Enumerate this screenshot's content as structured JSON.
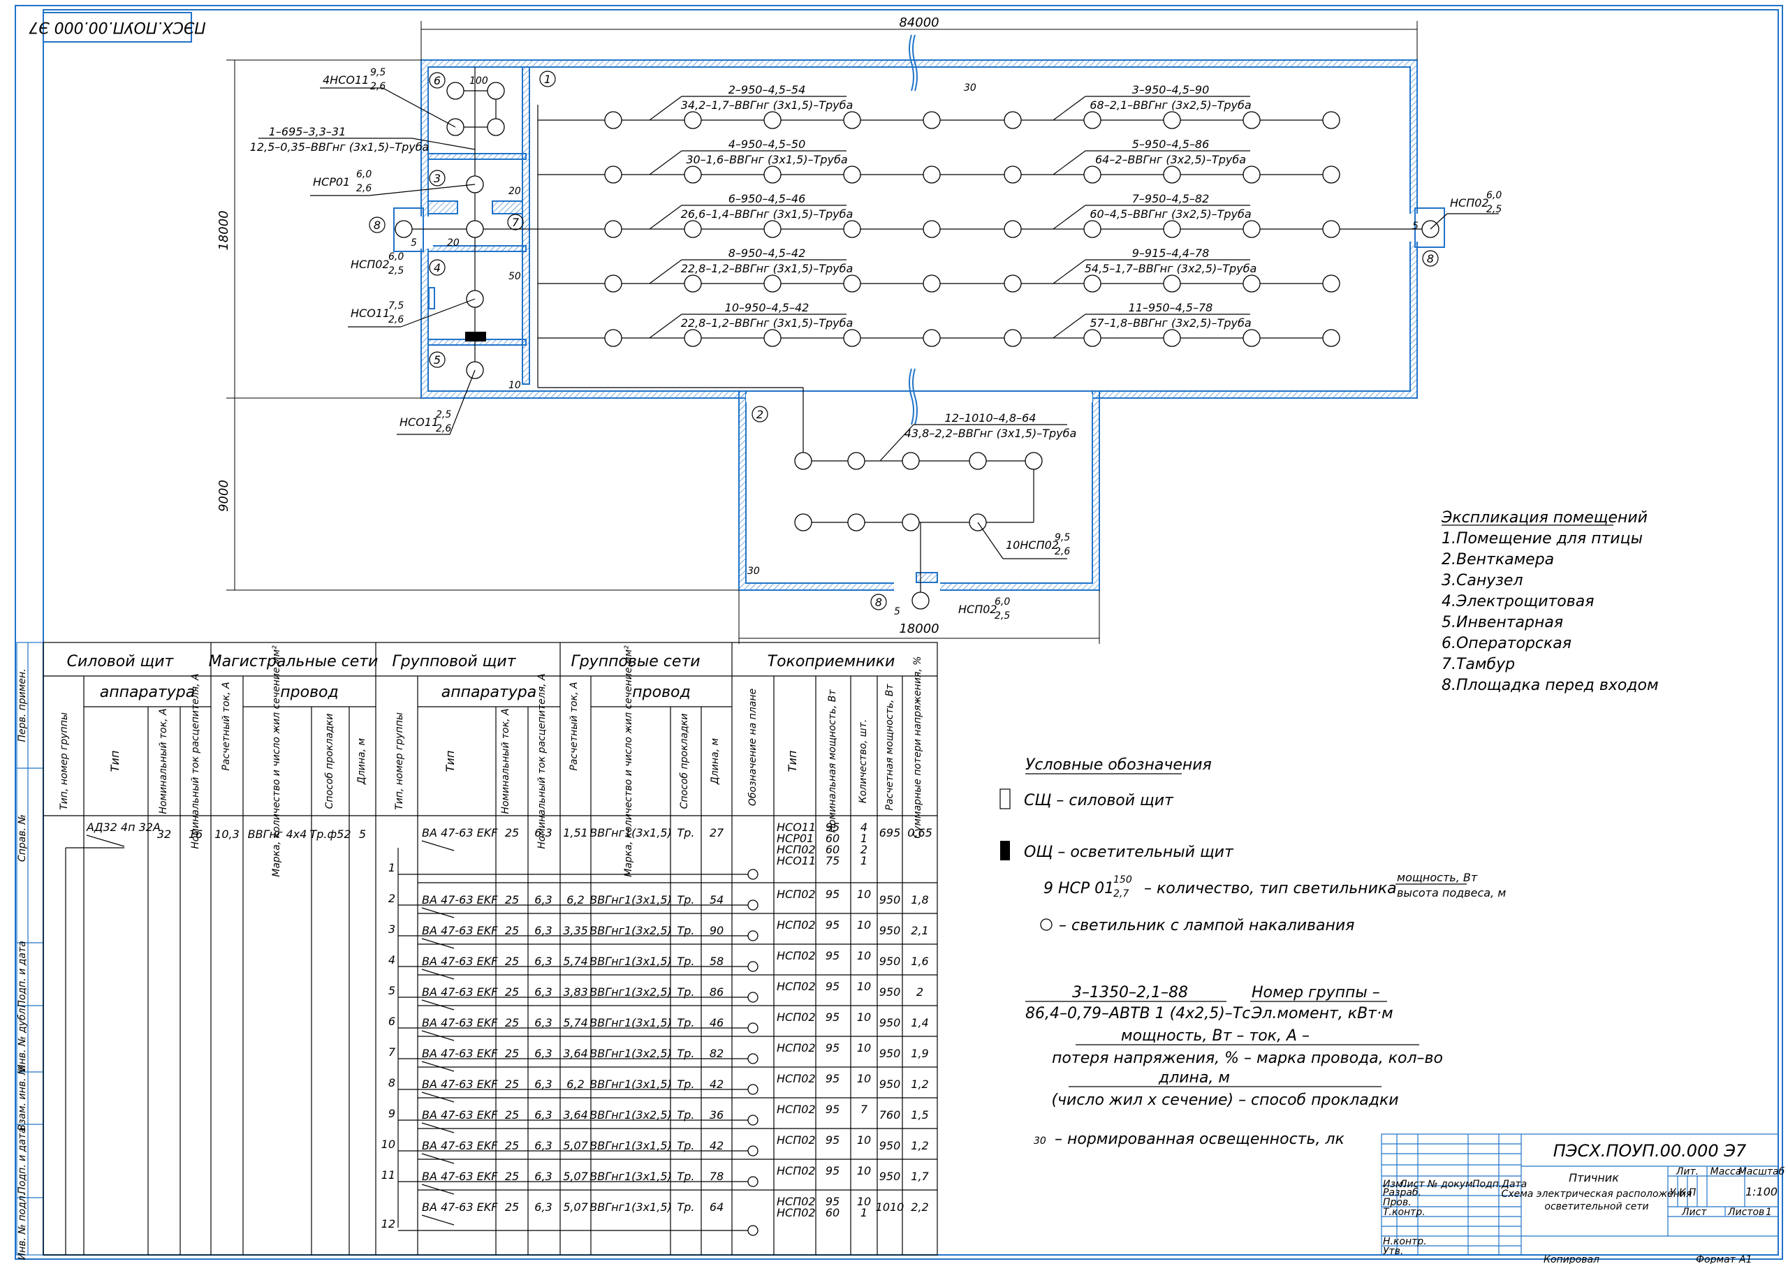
{
  "stamp_code": "ПЭСХ.ПОУП.00.000 Э7",
  "dimensions": {
    "overall_width": "84000",
    "depth_main": "18000",
    "depth_annex": "9000",
    "annex_width": "18000"
  },
  "rooms": [
    "1",
    "2",
    "3",
    "4",
    "5",
    "6",
    "7",
    "8"
  ],
  "group_labels": [
    {
      "top": "2–950–4,5–54",
      "bottom": "34,2–1,7–ВВГнг (3х1,5)–Труба"
    },
    {
      "top": "3–950–4,5–90",
      "bottom": "68–2,1–ВВГнг (3х2,5)–Труба"
    },
    {
      "top": "4–950–4,5–50",
      "bottom": "30–1,6–ВВГнг (3х1,5)–Труба"
    },
    {
      "top": "5–950–4,5–86",
      "bottom": "64–2–ВВГнг (3х2,5)–Труба"
    },
    {
      "top": "6–950–4,5–46",
      "bottom": "26,6–1,4–ВВГнг (3х1,5)–Труба"
    },
    {
      "top": "7–950–4,5–82",
      "bottom": "60–4,5–ВВГнг (3х2,5)–Труба"
    },
    {
      "top": "8–950–4,5–42",
      "bottom": "22,8–1,2–ВВГнг (3х1,5)–Труба"
    },
    {
      "top": "9–915–4,4–78",
      "bottom": "54,5–1,7–ВВГнг (3х2,5)–Труба"
    },
    {
      "top": "10–950–4,5–42",
      "bottom": "22,8–1,2–ВВГнг (3х1,5)–Труба"
    },
    {
      "top": "11–950–4,5–78",
      "bottom": "57–1,8–ВВГнг (3х2,5)–Труба"
    },
    {
      "top": "12–1010–4,8–64",
      "bottom": "43,8–2,2–ВВГнг (3х1,5)–Труба"
    },
    {
      "top": "1–695–3,3–31",
      "bottom": "12,5–0,35–ВВГнг (3х1,5)–Труба"
    }
  ],
  "lamp_labels": {
    "l1": {
      "name": "4НСО11",
      "num": "9,5",
      "den": "2,6"
    },
    "l2": {
      "name": "НСР01",
      "num": "6,0",
      "den": "2,6"
    },
    "l3": {
      "name": "НСП02",
      "num": "6,0",
      "den": "2,5"
    },
    "l4": {
      "name": "НСО11",
      "num": "7,5",
      "den": "2,6"
    },
    "l5": {
      "name": "НСО11",
      "num": "2,5",
      "den": "2,6"
    },
    "l6": {
      "name": "НСП02",
      "num": "6,0",
      "den": "2,5"
    },
    "l7": {
      "name": "10НСП02",
      "num": "9,5",
      "den": "2,6"
    },
    "l8": {
      "name": "НСП02",
      "num": "6,0",
      "den": "2,5"
    }
  },
  "lux": [
    "100",
    "30",
    "20",
    "20",
    "50",
    "10",
    "30",
    "5",
    "5",
    "5"
  ],
  "explication": {
    "title": "Экспликация помещений",
    "items": [
      "1.Помещение для птицы",
      "2.Венткамера",
      "3.Санузел",
      "4.Электрощитовая",
      "5.Инвентарная",
      "6.Операторская",
      "7.Тамбур",
      "8.Площадка перед входом"
    ]
  },
  "legend": {
    "title": "Условные обозначения",
    "sch": "СЩ – силовой щит",
    "osch": "ОЩ – осветительный щит",
    "lamp_type_example": "9 НСР 01",
    "lamp_type_num": "150",
    "lamp_type_den": "2,7",
    "lamp_type_text": "– количество, тип светильника",
    "power_label": "мощность, Вт",
    "height_label": "высота подвеса, м",
    "lamp_text": "– светильник с лампой накаливания",
    "formula_top": "3–1350–2,1–88",
    "formula_bottom": "86,4–0,79–АВТВ 1 (4х2,5)–Тс.",
    "desc1": "Номер группы  –",
    "desc2": "Эл.момент, кВт·м",
    "desc3": "мощность, Вт – ток, А –",
    "desc4": "потеря напряжения, % – марка провода, кол–во",
    "desc5": "длина, м",
    "desc6": "(число жил х сечение) – способ прокладки",
    "lux_value": "30",
    "lux_text": "– нормированная освещенность, лк"
  },
  "table": {
    "h_power_panel": "Силовой щит",
    "h_mains": "Магистральные сети",
    "h_group_panel": "Групповой щит",
    "h_group_nets": "Групповые сети",
    "h_receivers": "Токоприемники",
    "h_apparatus": "аппаратура",
    "h_wire": "провод",
    "col_type_group": "Тип, номер группы",
    "col_type": "Тип",
    "col_nom_current": "Номинальный ток, А",
    "col_trip_current": "Номинальный ток расцепителя, А",
    "col_calc_current": "Расчетный ток, А",
    "col_brand": "Марка, количество и число жил сечение,мм²",
    "col_method": "Способ прокладки",
    "col_length": "Длина, м",
    "col_designation": "Обозначение на плане",
    "col_nom_power": "Номинальная мощность, Вт",
    "col_qty": "Количество, шт.",
    "col_calc_power": "Расчетная мощность, Вт",
    "col_loss": "Суммарные потери напряжения, %",
    "main": {
      "type": "АД32 4п 32А",
      "nom": "32",
      "trip": "16",
      "calc": "10,3",
      "wire": "ВВГнг 4х4",
      "method": "Тр.ф52",
      "len": "5"
    },
    "rows": [
      {
        "g": "1",
        "type": "ВА 47-63 EKF",
        "nom": "25",
        "trip": "6,3",
        "calc": "1,51",
        "wire": "ВВГнг1(3х1,5)",
        "m": "Тр.",
        "len": "27",
        "lamps": [
          "НСО11",
          "НСР01",
          "НСП02",
          "НСО11"
        ],
        "pw": [
          "95",
          "60",
          "60",
          "75"
        ],
        "qty": [
          "4",
          "1",
          "2",
          "1"
        ],
        "cp": "695",
        "loss": "0,65"
      },
      {
        "g": "2",
        "type": "ВА 47-63 EKF",
        "nom": "25",
        "trip": "6,3",
        "calc": "6,2",
        "wire": "ВВГнг1(3х1,5)",
        "m": "Тр.",
        "len": "54",
        "lamps": [
          "НСП02"
        ],
        "pw": [
          "95"
        ],
        "qty": [
          "10"
        ],
        "cp": "950",
        "loss": "1,8"
      },
      {
        "g": "3",
        "type": "ВА 47-63 EKF",
        "nom": "25",
        "trip": "6,3",
        "calc": "3,35",
        "wire": "ВВГнг1(3х2,5)",
        "m": "Тр.",
        "len": "90",
        "lamps": [
          "НСП02"
        ],
        "pw": [
          "95"
        ],
        "qty": [
          "10"
        ],
        "cp": "950",
        "loss": "2,1"
      },
      {
        "g": "4",
        "type": "ВА 47-63 EKF",
        "nom": "25",
        "trip": "6,3",
        "calc": "5,74",
        "wire": "ВВГнг1(3х1,5)",
        "m": "Тр.",
        "len": "58",
        "lamps": [
          "НСП02"
        ],
        "pw": [
          "95"
        ],
        "qty": [
          "10"
        ],
        "cp": "950",
        "loss": "1,6"
      },
      {
        "g": "5",
        "type": "ВА 47-63 EKF",
        "nom": "25",
        "trip": "6,3",
        "calc": "3,83",
        "wire": "ВВГнг1(3х2,5)",
        "m": "Тр.",
        "len": "86",
        "lamps": [
          "НСП02"
        ],
        "pw": [
          "95"
        ],
        "qty": [
          "10"
        ],
        "cp": "950",
        "loss": "2"
      },
      {
        "g": "6",
        "type": "ВА 47-63 EKF",
        "nom": "25",
        "trip": "6,3",
        "calc": "5,74",
        "wire": "ВВГнг1(3х1,5)",
        "m": "Тр.",
        "len": "46",
        "lamps": [
          "НСП02"
        ],
        "pw": [
          "95"
        ],
        "qty": [
          "10"
        ],
        "cp": "950",
        "loss": "1,4"
      },
      {
        "g": "7",
        "type": "ВА 47-63 EKF",
        "nom": "25",
        "trip": "6,3",
        "calc": "3,64",
        "wire": "ВВГнг1(3х2,5)",
        "m": "Тр.",
        "len": "82",
        "lamps": [
          "НСП02"
        ],
        "pw": [
          "95"
        ],
        "qty": [
          "10"
        ],
        "cp": "950",
        "loss": "1,9"
      },
      {
        "g": "8",
        "type": "ВА 47-63 EKF",
        "nom": "25",
        "trip": "6,3",
        "calc": "6,2",
        "wire": "ВВГнг1(3х1,5)",
        "m": "Тр.",
        "len": "42",
        "lamps": [
          "НСП02"
        ],
        "pw": [
          "95"
        ],
        "qty": [
          "10"
        ],
        "cp": "950",
        "loss": "1,2"
      },
      {
        "g": "9",
        "type": "ВА 47-63 EKF",
        "nom": "25",
        "trip": "6,3",
        "calc": "3,64",
        "wire": "ВВГнг1(3х2,5)",
        "m": "Тр.",
        "len": "36",
        "lamps": [
          "НСП02"
        ],
        "pw": [
          "95"
        ],
        "qty": [
          "7"
        ],
        "cp": "760",
        "loss": "1,5"
      },
      {
        "g": "10",
        "type": "ВА 47-63 EKF",
        "nom": "25",
        "trip": "6,3",
        "calc": "5,07",
        "wire": "ВВГнг1(3х1,5)",
        "m": "Тр.",
        "len": "42",
        "lamps": [
          "НСП02"
        ],
        "pw": [
          "95"
        ],
        "qty": [
          "10"
        ],
        "cp": "950",
        "loss": "1,2"
      },
      {
        "g": "11",
        "type": "ВА 47-63 EKF",
        "nom": "25",
        "trip": "6,3",
        "calc": "5,07",
        "wire": "ВВГнг1(3х1,5)",
        "m": "Тр.",
        "len": "78",
        "lamps": [
          "НСП02"
        ],
        "pw": [
          "95"
        ],
        "qty": [
          "10"
        ],
        "cp": "950",
        "loss": "1,7"
      },
      {
        "g": "12",
        "type": "ВА 47-63 EKF",
        "nom": "25",
        "trip": "6,3",
        "calc": "5,07",
        "wire": "ВВГнг1(3х1,5)",
        "m": "Тр.",
        "len": "64",
        "lamps": [
          "НСП02",
          "НСП02"
        ],
        "pw": [
          "95",
          "60"
        ],
        "qty": [
          "10",
          "1"
        ],
        "cp": "1010",
        "loss": "2,2"
      }
    ]
  },
  "side_strip": [
    "Перв. примен.",
    "Справ. №",
    "Подп. и дата",
    "Инв. № дубл.",
    "Взам. инв. №",
    "Подп. и дата",
    "Инв. № подл."
  ],
  "title_block": {
    "code": "ПЭСХ.ПОУП.00.000 Э7",
    "object": "Птичник",
    "sheet_title_1": "Схема электрическая расположения",
    "sheet_title_2": "осветительной сети",
    "lit": "Лит.",
    "mass": "Масса",
    "scale_label": "Масштаб",
    "lit_values": [
      "У",
      "К",
      "П"
    ],
    "scale": "1:100",
    "sheet": "Лист",
    "sheets": "Листов",
    "sheets_value": "1",
    "rows": [
      "Изм.",
      "Лист",
      "№ докум.",
      "Подп.",
      "Дата",
      "Разраб.",
      "Пров.",
      "Т.контр.",
      "Н.контр.",
      "Утв."
    ],
    "copied": "Копировал",
    "format": "Формат",
    "format_value": "А1"
  }
}
